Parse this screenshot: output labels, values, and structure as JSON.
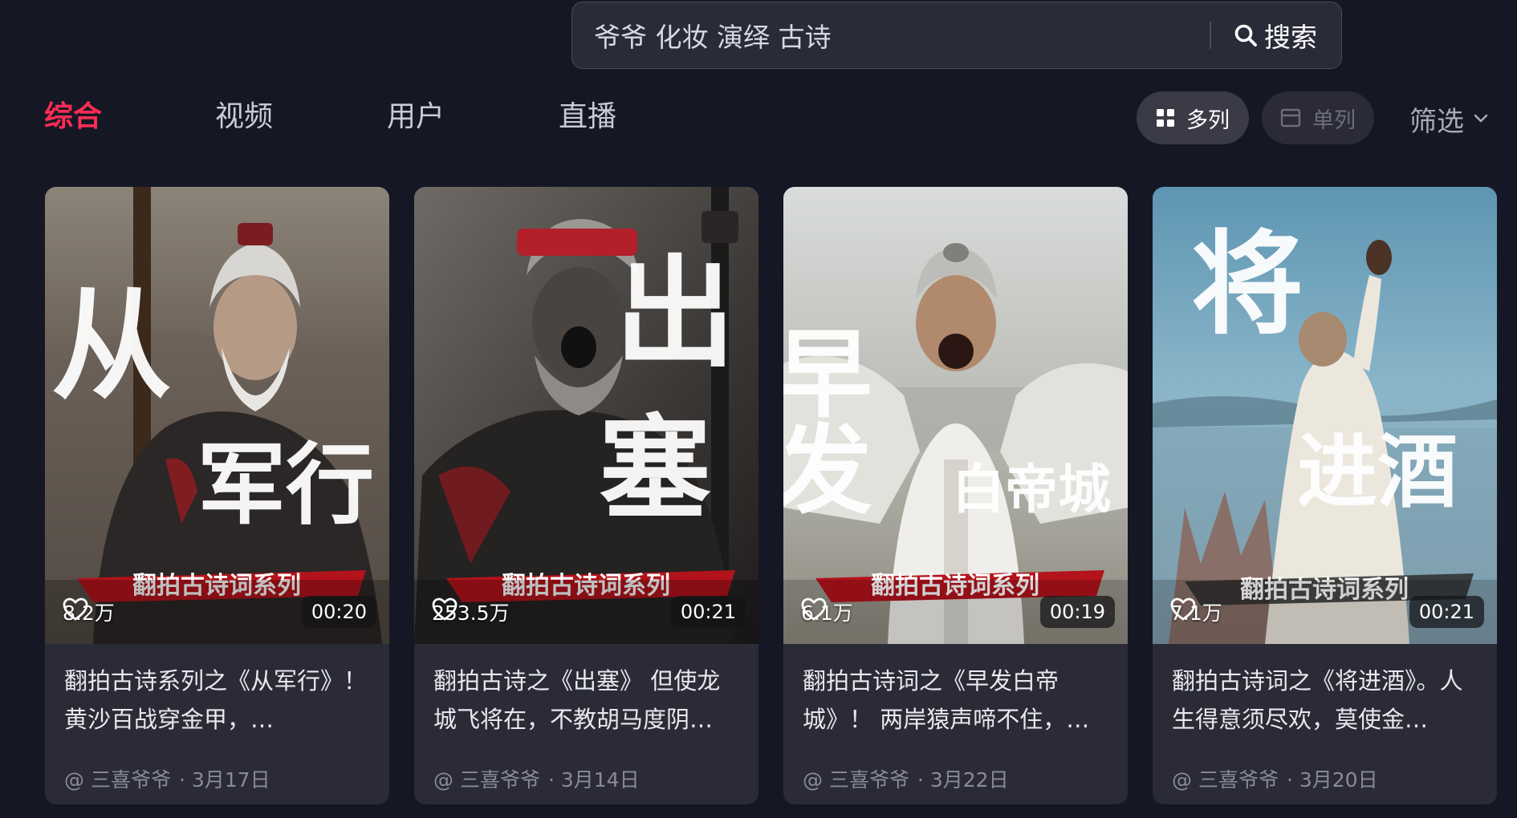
{
  "search": {
    "value": "爷爷 化妆 演绎 古诗",
    "button_label": "搜索"
  },
  "tabs": [
    {
      "label": "综合",
      "active": true
    },
    {
      "label": "视频",
      "active": false
    },
    {
      "label": "用户",
      "active": false
    },
    {
      "label": "直播",
      "active": false
    }
  ],
  "view": {
    "multi_label": "多列",
    "single_label": "单列",
    "selected": "多列"
  },
  "filter": {
    "label": "筛选"
  },
  "colors": {
    "background": "#161724",
    "accent": "#fe2c55",
    "card": "#2a2b37",
    "banner_red": "#b3131b"
  },
  "cards": [
    {
      "big_text_1": "从",
      "big_text_2": "军行",
      "series_banner": "翻拍古诗词系列",
      "likes": "8.2万",
      "duration": "00:20",
      "title": "翻拍古诗系列之《从军行》！ 黄沙百战穿金甲，…",
      "author": "@ 三喜爷爷",
      "date": "· 3月17日"
    },
    {
      "big_text_1": "出",
      "big_text_2": "塞",
      "series_banner": "翻拍古诗词系列",
      "likes": "253.5万",
      "duration": "00:21",
      "title": "翻拍古诗之《出塞》 但使龙城飞将在，不教胡马度阴…",
      "author": "@ 三喜爷爷",
      "date": "· 3月14日"
    },
    {
      "big_text_1": "早发",
      "big_text_2": "白帝城",
      "series_banner": "翻拍古诗词系列",
      "likes": "6.1万",
      "duration": "00:19",
      "title": "翻拍古诗词之《早发白帝城》！ 两岸猿声啼不住，…",
      "author": "@ 三喜爷爷",
      "date": "· 3月22日"
    },
    {
      "big_text_1": "将",
      "big_text_2": "进酒",
      "series_banner": "翻拍古诗词系列",
      "likes": "7.1万",
      "duration": "00:21",
      "title": "翻拍古诗词之《将进酒》。人生得意须尽欢，莫使金…",
      "author": "@ 三喜爷爷",
      "date": "· 3月20日"
    }
  ]
}
